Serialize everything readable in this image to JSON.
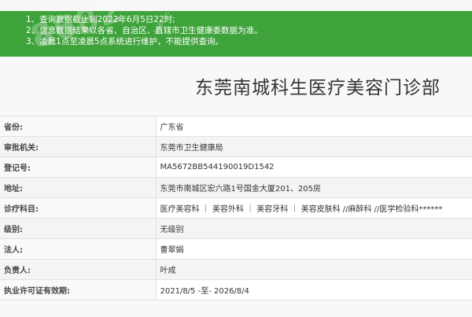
{
  "notice": {
    "lines": [
      "1、查询数据截止到2022年6月5日22时;",
      "2、信息数据结果以各省、自治区、直辖市卫生健康委数据为准。",
      "3、凌晨1点至凌晨5点系统进行维护，不能提供查询。"
    ],
    "watermark": "8682",
    "watermark_small": "8682.cc",
    "background_color": "#3fa33b"
  },
  "title": "东莞南城科生医疗美容门诊部",
  "details": {
    "province": {
      "label": "省份:",
      "value": "广东省"
    },
    "authority": {
      "label": "审批机关:",
      "value": "东莞市卫生健康局"
    },
    "registration": {
      "label": "登记号:",
      "value": "MA5672BB544190019D1542"
    },
    "address": {
      "label": "地址:",
      "value": "东莞市南城区宏六路1号国金大厦201、205房"
    },
    "subjects": {
      "label": "诊疗科目:",
      "value": "医疗美容科 ｜ 美容外科 ｜ 美容牙科 ｜ 美容皮肤科 //麻醉科 //医学检验科******"
    },
    "level": {
      "label": "级别:",
      "value": "无级别"
    },
    "legal_person": {
      "label": "法人:",
      "value": "曹翠娟"
    },
    "manager": {
      "label": "负责人:",
      "value": "叶成"
    },
    "license_validity": {
      "label": "执业许可证有效期:",
      "value": "2021/8/5 -至- 2026/8/4"
    }
  }
}
